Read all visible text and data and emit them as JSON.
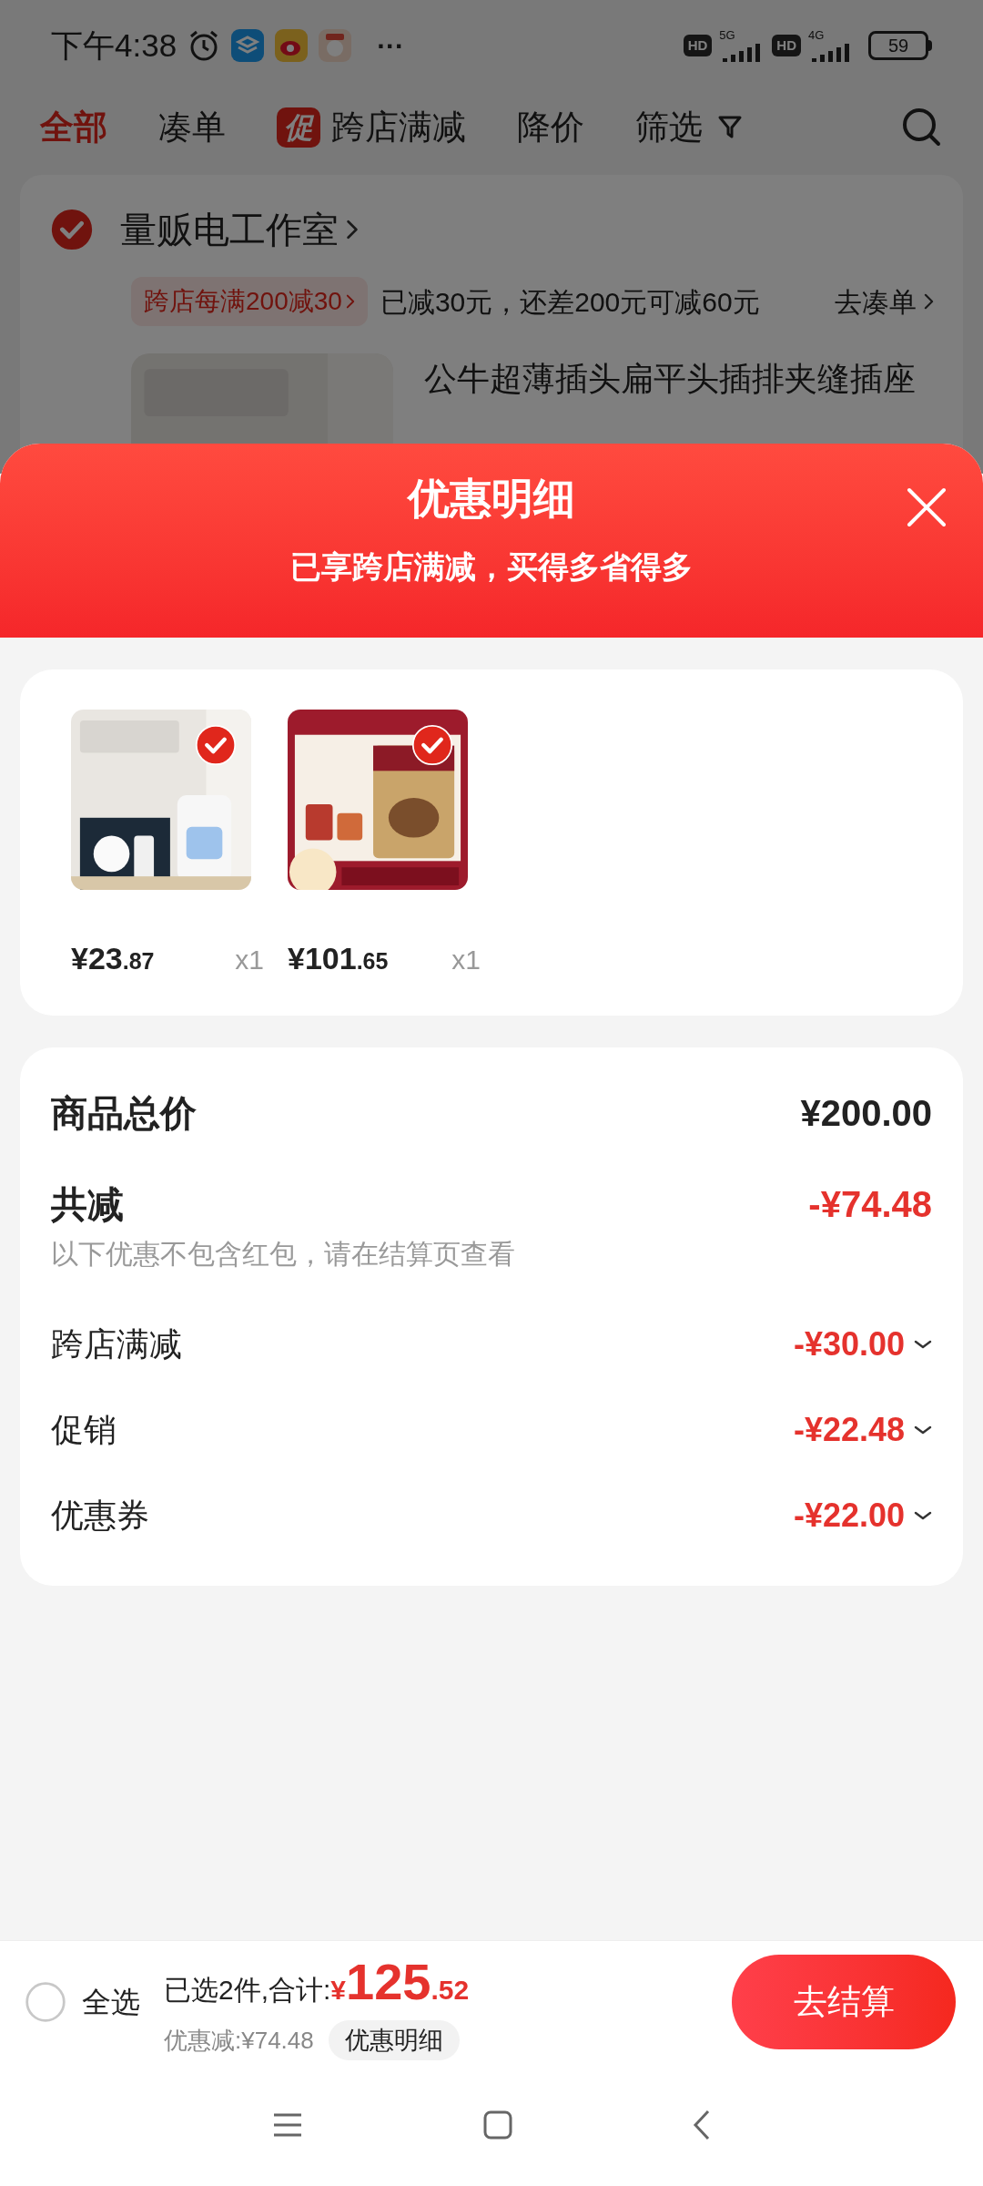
{
  "status_bar": {
    "time": "下午4:38",
    "more": "···",
    "sim1": {
      "hd": "HD",
      "net": "5G"
    },
    "sim2": {
      "hd": "HD",
      "net": "4G"
    },
    "battery": "59"
  },
  "background": {
    "tabs": [
      {
        "label": "全部",
        "selected": true,
        "kind": "plain"
      },
      {
        "label": "凑单",
        "selected": false,
        "kind": "plain"
      },
      {
        "label": "跨店满减",
        "badge": "促",
        "selected": false,
        "kind": "badge"
      },
      {
        "label": "降价",
        "selected": false,
        "kind": "plain"
      },
      {
        "label": "筛选",
        "selected": false,
        "kind": "filter"
      }
    ],
    "store": {
      "name": "量贩电工作室",
      "checked": true,
      "promo_tag": "跨店每满200减30",
      "promo_text": "已减30元，还差200元可减60元",
      "promo_link": "去凑单",
      "product_title": "公牛超薄插头扁平头插排夹缝插座"
    }
  },
  "sheet": {
    "title": "优惠明细",
    "subtitle": "已享跨店满减，买得多省得多",
    "products": [
      {
        "selected": true,
        "price": "¥23",
        "decimal": ".87",
        "qty": "x1"
      },
      {
        "selected": true,
        "price": "¥101",
        "decimal": ".65",
        "qty": "x1"
      }
    ],
    "summary": [
      {
        "kind": "total",
        "label": "商品总价",
        "value": "¥200.00"
      },
      {
        "kind": "discount",
        "label": "共减",
        "value": "-¥74.48",
        "note": "以下优惠不包含红包，请在结算页查看"
      },
      {
        "kind": "item",
        "label": "跨店满减",
        "value": "-¥30.00",
        "expanded": false
      },
      {
        "kind": "item",
        "label": "促销",
        "value": "-¥22.48",
        "expanded": false
      },
      {
        "kind": "item",
        "label": "优惠券",
        "value": "-¥22.00",
        "expanded": false
      }
    ]
  },
  "bottom_bar": {
    "select_all": {
      "label": "全选",
      "checked": false
    },
    "selected_text": "已选2件,合计:",
    "currency": "¥",
    "total": "125",
    "total_decimal": ".52",
    "saved": "优惠减:¥74.48",
    "detail_button": "优惠明细",
    "checkout": "去结算"
  }
}
